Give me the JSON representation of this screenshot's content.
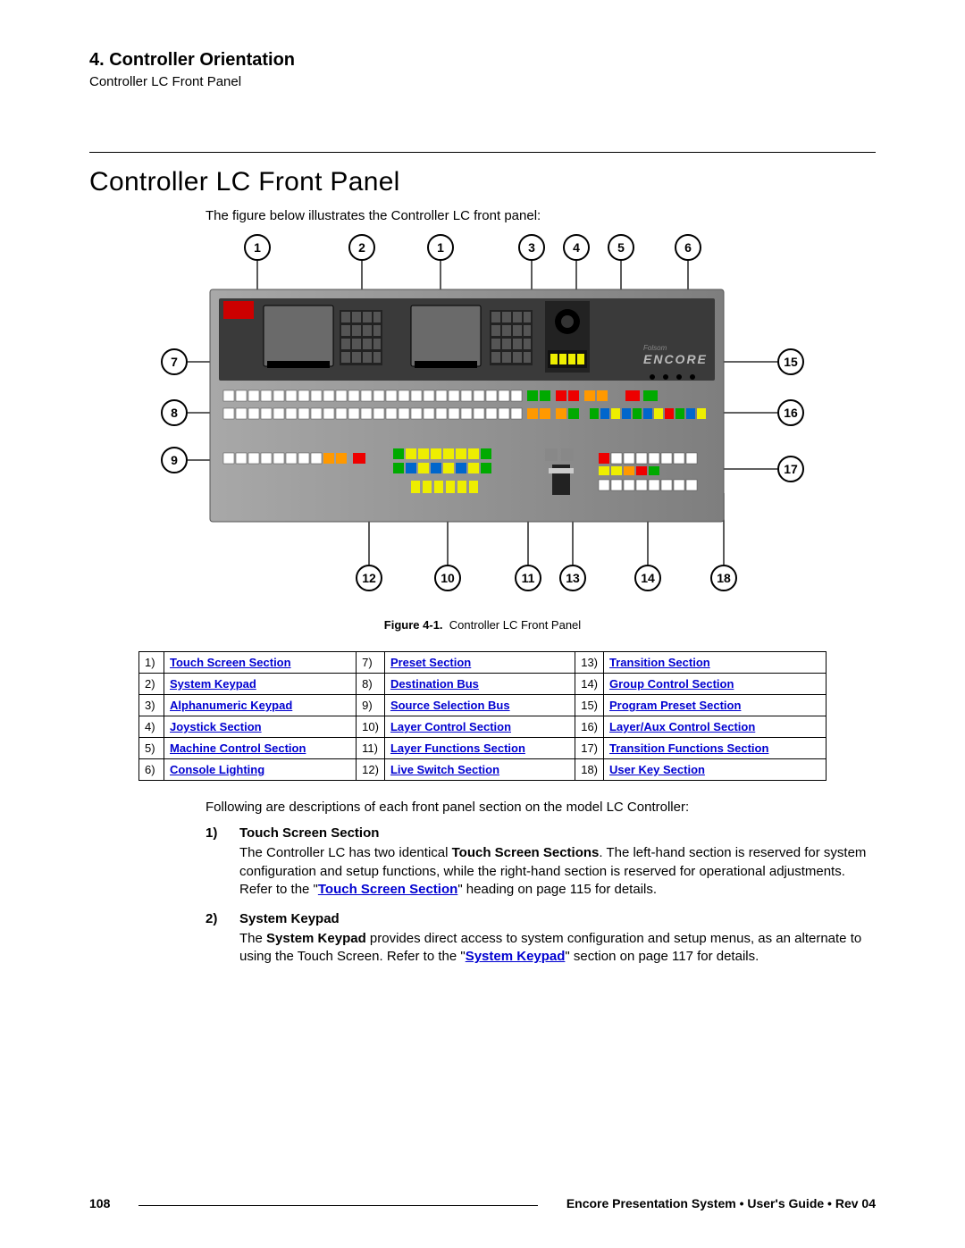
{
  "header": {
    "chapter": "4.  Controller Orientation",
    "subtitle": "Controller LC Front Panel"
  },
  "section": {
    "title": "Controller LC Front Panel",
    "intro": "The figure below illustrates the Controller LC front panel:"
  },
  "figure": {
    "label": "Figure 4-1.",
    "caption": "Controller LC Front Panel",
    "brand_small": "Folsom",
    "brand": "ENCORE"
  },
  "callouts_top": [
    "1",
    "2",
    "1",
    "3",
    "4",
    "5",
    "6"
  ],
  "callouts_left": [
    "7",
    "8",
    "9"
  ],
  "callouts_right": [
    "15",
    "16",
    "17"
  ],
  "callouts_bottom": [
    "12",
    "10",
    "11",
    "13",
    "14",
    "18"
  ],
  "legend": [
    {
      "n": "1)",
      "t": "Touch Screen Section"
    },
    {
      "n": "2)",
      "t": "System Keypad"
    },
    {
      "n": "3)",
      "t": "Alphanumeric Keypad"
    },
    {
      "n": "4)",
      "t": "Joystick Section"
    },
    {
      "n": "5)",
      "t": "Machine Control Section"
    },
    {
      "n": "6)",
      "t": "Console Lighting"
    },
    {
      "n": "7)",
      "t": "Preset Section"
    },
    {
      "n": "8)",
      "t": "Destination Bus"
    },
    {
      "n": "9)",
      "t": "Source Selection Bus"
    },
    {
      "n": "10)",
      "t": "Layer Control Section"
    },
    {
      "n": "11)",
      "t": "Layer Functions Section"
    },
    {
      "n": "12)",
      "t": "Live Switch Section"
    },
    {
      "n": "13)",
      "t": "Transition Section"
    },
    {
      "n": "14)",
      "t": "Group Control Section"
    },
    {
      "n": "15)",
      "t": "Program Preset Section"
    },
    {
      "n": "16)",
      "t": "Layer/Aux Control Section"
    },
    {
      "n": "17)",
      "t": "Transition Functions Section"
    },
    {
      "n": "18)",
      "t": "User Key Section"
    }
  ],
  "descriptions": {
    "intro": "Following are descriptions of each front panel section on the model LC Controller:",
    "items": [
      {
        "num": "1)",
        "title": "Touch Screen Section",
        "pre": "The Controller LC has two identical ",
        "bold1": "Touch Screen Sections",
        "mid": ".  The left-hand section is reserved for system configuration and setup functions, while the right-hand section is reserved for operational adjustments.  Refer to the \"",
        "link": "Touch Screen Section",
        "post": "\" heading on page 115 for details."
      },
      {
        "num": "2)",
        "title": "System Keypad",
        "pre": "The ",
        "bold1": "System Keypad",
        "mid": " provides direct access to system configuration and setup menus, as an alternate to using the Touch Screen.  Refer to the \"",
        "link": "System Keypad",
        "post": "\" section on page 117 for details."
      }
    ]
  },
  "footer": {
    "page": "108",
    "doc": "Encore Presentation System  •  User's Guide  •  Rev 04"
  }
}
